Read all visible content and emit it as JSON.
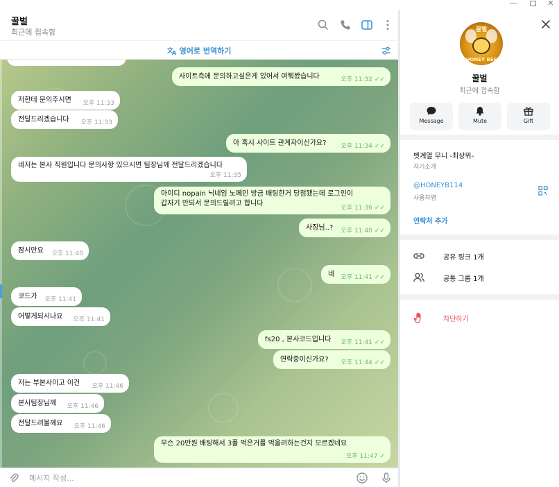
{
  "window": {
    "minimize_glyph": "—",
    "close_glyph": "✕"
  },
  "chat": {
    "title": "꿀벌",
    "status": "최근에 접속함",
    "translate_label": "영어로 번역하기",
    "input_placeholder": "메시지 작성...",
    "messages": [
      {
        "dir": "out",
        "text": "사이트측에 문의하고싶은게 있어서 여쭤봤습니다",
        "time": "오후 11:32",
        "read": true
      },
      {
        "dir": "in",
        "text": "저한테 문의주시면",
        "time": "오후 11:33"
      },
      {
        "dir": "in",
        "text": "전달드리겠습니다",
        "time": "오후 11:33"
      },
      {
        "dir": "out",
        "text": "아 혹시 사이트 관계자이신가요?",
        "time": "오후 11:34",
        "read": true
      },
      {
        "dir": "in",
        "text": "네저는 본사 직원입니다 문의사항 있으시면 팀장님께 전달드리겠습니다",
        "time": "오후 11:35"
      },
      {
        "dir": "out",
        "text": "아이디 nopain 닉네임 노페인 방금 배팅한거 당첨됐는데 로그인이",
        "text2": "갑자기 안되서 문의드릴려고 합니다",
        "time": "오후 11:36",
        "read": true
      },
      {
        "dir": "out",
        "text": "사장님..?",
        "time": "오후 11:40",
        "read": true
      },
      {
        "dir": "in",
        "text": "잠시만요",
        "time": "오후 11:40"
      },
      {
        "dir": "out",
        "text": "네",
        "time": "오후 11:41",
        "read": true
      },
      {
        "dir": "in",
        "text": "코드가",
        "time": "오후 11:41"
      },
      {
        "dir": "in",
        "text": "어떻게되시나요",
        "time": "오후 11:41"
      },
      {
        "dir": "out",
        "text": "fs20 , 본사코드입니다",
        "time": "오후 11:41",
        "read": true
      },
      {
        "dir": "out",
        "text": "연락중이신가요?",
        "time": "오후 11:44",
        "read": true
      },
      {
        "dir": "in",
        "text": "저는 부본사이고 이건",
        "time": "오후 11:46"
      },
      {
        "dir": "in",
        "text": "본사팀장님께",
        "time": "오후 11:46"
      },
      {
        "dir": "in",
        "text": "전달드려볼께요",
        "time": "오후 11:46"
      },
      {
        "dir": "out",
        "text": "무슨 20만원 배팅해서 3폴 먹은거를 먹을려하는건지 모르겠네요",
        "time": "오후 11:47",
        "read": false
      }
    ]
  },
  "profile": {
    "avatar_text": "꿀벌",
    "avatar_banner": "HONEY BEE",
    "name": "꿀벌",
    "status": "최근에 접속함",
    "actions": [
      {
        "label": "Message",
        "icon": "chat-bubble-icon"
      },
      {
        "label": "Mute",
        "icon": "bell-icon"
      },
      {
        "label": "Gift",
        "icon": "gift-icon"
      }
    ],
    "bio": "벳계열 무니 -최상위-",
    "bio_label": "자기소개",
    "username": "@HONEYB114",
    "username_label": "사용자명",
    "add_contact": "연락처 추가",
    "shared_links": "공유 링크 1개",
    "common_groups": "공통 그룹 1개",
    "block": "차단하기"
  },
  "colors": {
    "accent": "#3b8fd1",
    "outgoing_bubble": "#eeffde",
    "incoming_bubble": "#ffffff",
    "danger": "#e25656"
  }
}
